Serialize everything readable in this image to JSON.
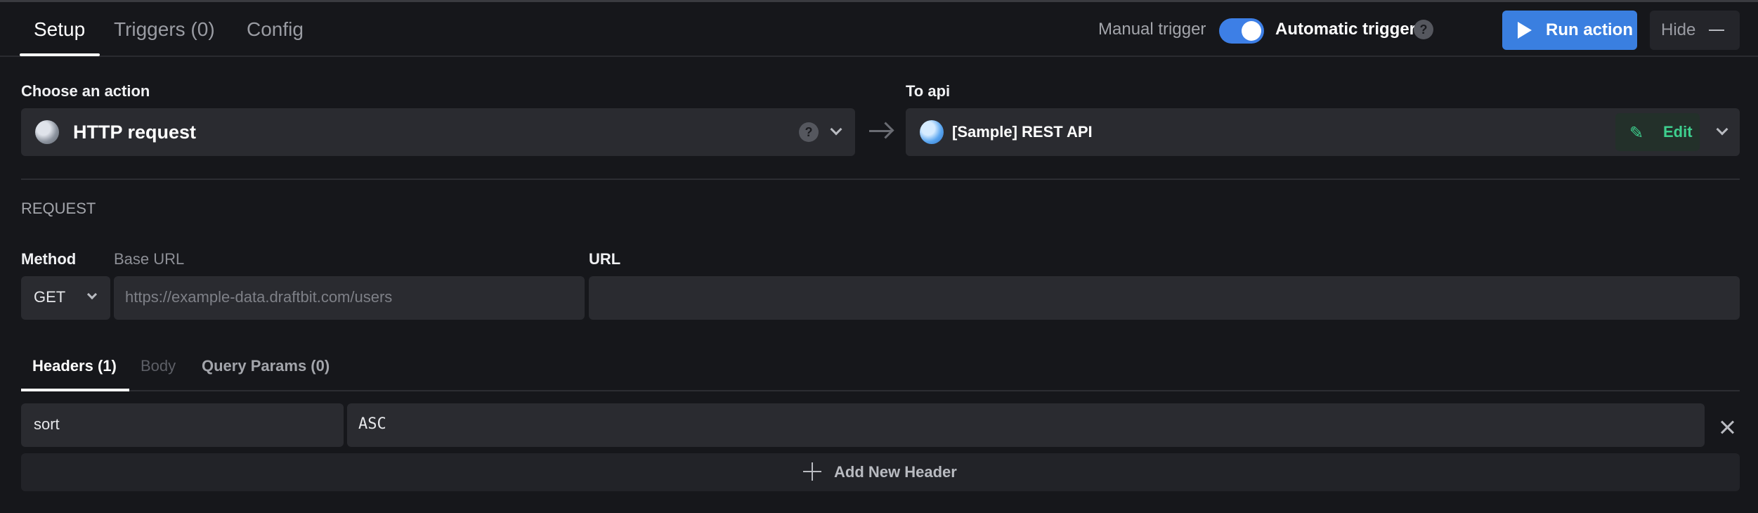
{
  "tabs": [
    {
      "label": "Setup",
      "active": true
    },
    {
      "label": "Triggers (0)",
      "active": false
    },
    {
      "label": "Config",
      "active": false
    }
  ],
  "trigger": {
    "manual_label": "Manual trigger",
    "automatic_label": "Automatic trigger",
    "help": "?",
    "toggle_on": true
  },
  "toolbar": {
    "run_label": "Run action",
    "hide_label": "Hide"
  },
  "action": {
    "label": "Choose an action",
    "value": "HTTP request",
    "help": "?"
  },
  "api": {
    "label": "To api",
    "value": "[Sample] REST API",
    "edit_label": "Edit"
  },
  "request": {
    "section_label": "REQUEST",
    "method_label": "Method",
    "method_value": "GET",
    "base_url_label": "Base URL",
    "base_url_placeholder": "https://example-data.draftbit.com/users",
    "url_label": "URL",
    "url_value": ""
  },
  "subtabs": [
    {
      "label": "Headers (1)",
      "active": true,
      "disabled": false
    },
    {
      "label": "Body",
      "active": false,
      "disabled": true
    },
    {
      "label": "Query Params (0)",
      "active": false,
      "disabled": false
    }
  ],
  "headers": [
    {
      "key": "sort",
      "value": "ASC"
    }
  ],
  "add_header_label": "Add New Header",
  "colors": {
    "accent": "#3a7fe0",
    "edit_green": "#3ecf8e",
    "background": "#16171b"
  }
}
